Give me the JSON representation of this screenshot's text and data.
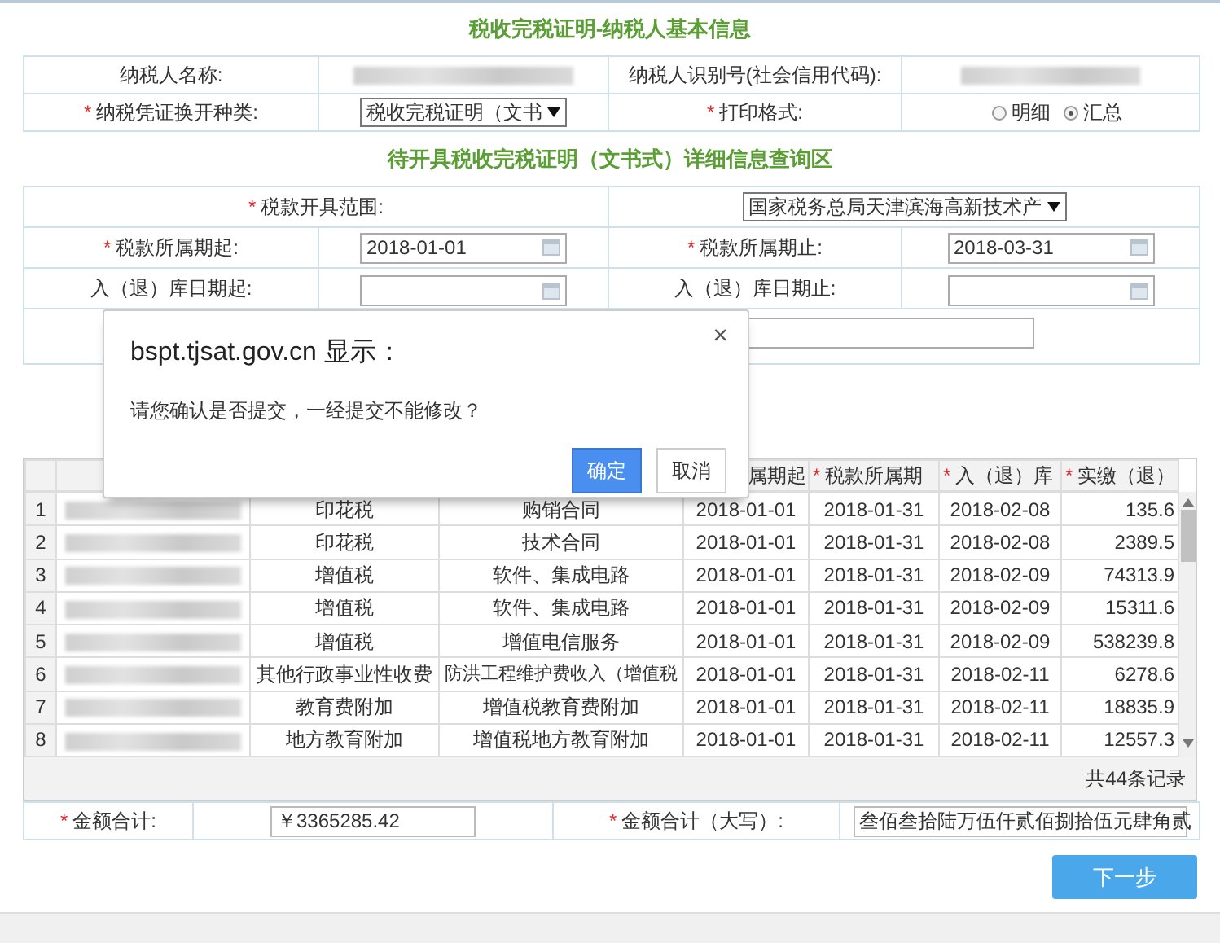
{
  "section_title": "税收完税证明-纳税人基本信息",
  "taxpayer": {
    "name_label": "纳税人名称:",
    "id_label": "纳税人识别号(社会信用代码):",
    "voucher": {
      "mark": "*",
      "label": "纳税凭证换开种类:",
      "value": "税收完税证明（文书"
    },
    "format": {
      "mark": "*",
      "label": "打印格式:",
      "options": [
        {
          "label": "明细",
          "selected": false
        },
        {
          "label": "汇总",
          "selected": true
        }
      ]
    }
  },
  "query_title": "待开具税收完税证明（文书式）详细信息查询区",
  "query": {
    "range": {
      "mark": "*",
      "label": "税款开具范围:",
      "value": "国家税务总局天津滨海高新技术产"
    },
    "pairs": [
      [
        {
          "mark": "*",
          "label": "税款所属期起:",
          "value": "2018-01-01"
        },
        {
          "mark": "*",
          "label": "税款所属期止:",
          "value": "2018-03-31"
        }
      ],
      [
        {
          "label": "入（退）库日期起:"
        },
        {
          "label": "入（退）库日期止:"
        }
      ]
    ]
  },
  "grid": {
    "columns": [
      "",
      "",
      "",
      {
        "label": "属期起"
      },
      {
        "mark": "*",
        "label": "税款所属期"
      },
      {
        "mark": "*",
        "label": "入（退）库"
      },
      {
        "mark": "*",
        "label": "实缴（退）"
      }
    ],
    "rows": [
      [
        "1",
        "印花税",
        "购销合同",
        "2018-01-01",
        "2018-01-31",
        "2018-02-08",
        "135.6"
      ],
      [
        "2",
        "印花税",
        "技术合同",
        "2018-01-01",
        "2018-01-31",
        "2018-02-08",
        "2389.5"
      ],
      [
        "3",
        "增值税",
        "软件、集成电路",
        "2018-01-01",
        "2018-01-31",
        "2018-02-09",
        "74313.9"
      ],
      [
        "4",
        "增值税",
        "软件、集成电路",
        "2018-01-01",
        "2018-01-31",
        "2018-02-09",
        "15311.6"
      ],
      [
        "5",
        "增值税",
        "增值电信服务",
        "2018-01-01",
        "2018-01-31",
        "2018-02-09",
        "538239.8"
      ],
      [
        "6",
        "其他行政事业性收费",
        "防洪工程维护费收入（增值税",
        "2018-01-01",
        "2018-01-31",
        "2018-02-11",
        "6278.6"
      ],
      [
        "7",
        "教育费附加",
        "增值税教育费附加",
        "2018-01-01",
        "2018-01-31",
        "2018-02-11",
        "18835.9"
      ],
      [
        "8",
        "地方教育附加",
        "增值税地方教育附加",
        "2018-01-01",
        "2018-01-31",
        "2018-02-11",
        "12557.3"
      ]
    ],
    "record_count": "共44条记录"
  },
  "totals": {
    "amount": {
      "mark": "*",
      "label": "金额合计:",
      "value": "￥3365285.42"
    },
    "amount_words": {
      "mark": "*",
      "label": "金额合计（大写）:",
      "value": "叁佰叁拾陆万伍仟贰佰捌拾伍元肆角贰"
    }
  },
  "next_button": "下一步",
  "dialog": {
    "title": "bspt.tjsat.gov.cn 显示：",
    "message": "请您确认是否提交，一经提交不能修改？",
    "ok": "确定",
    "cancel": "取消",
    "close": "×"
  }
}
